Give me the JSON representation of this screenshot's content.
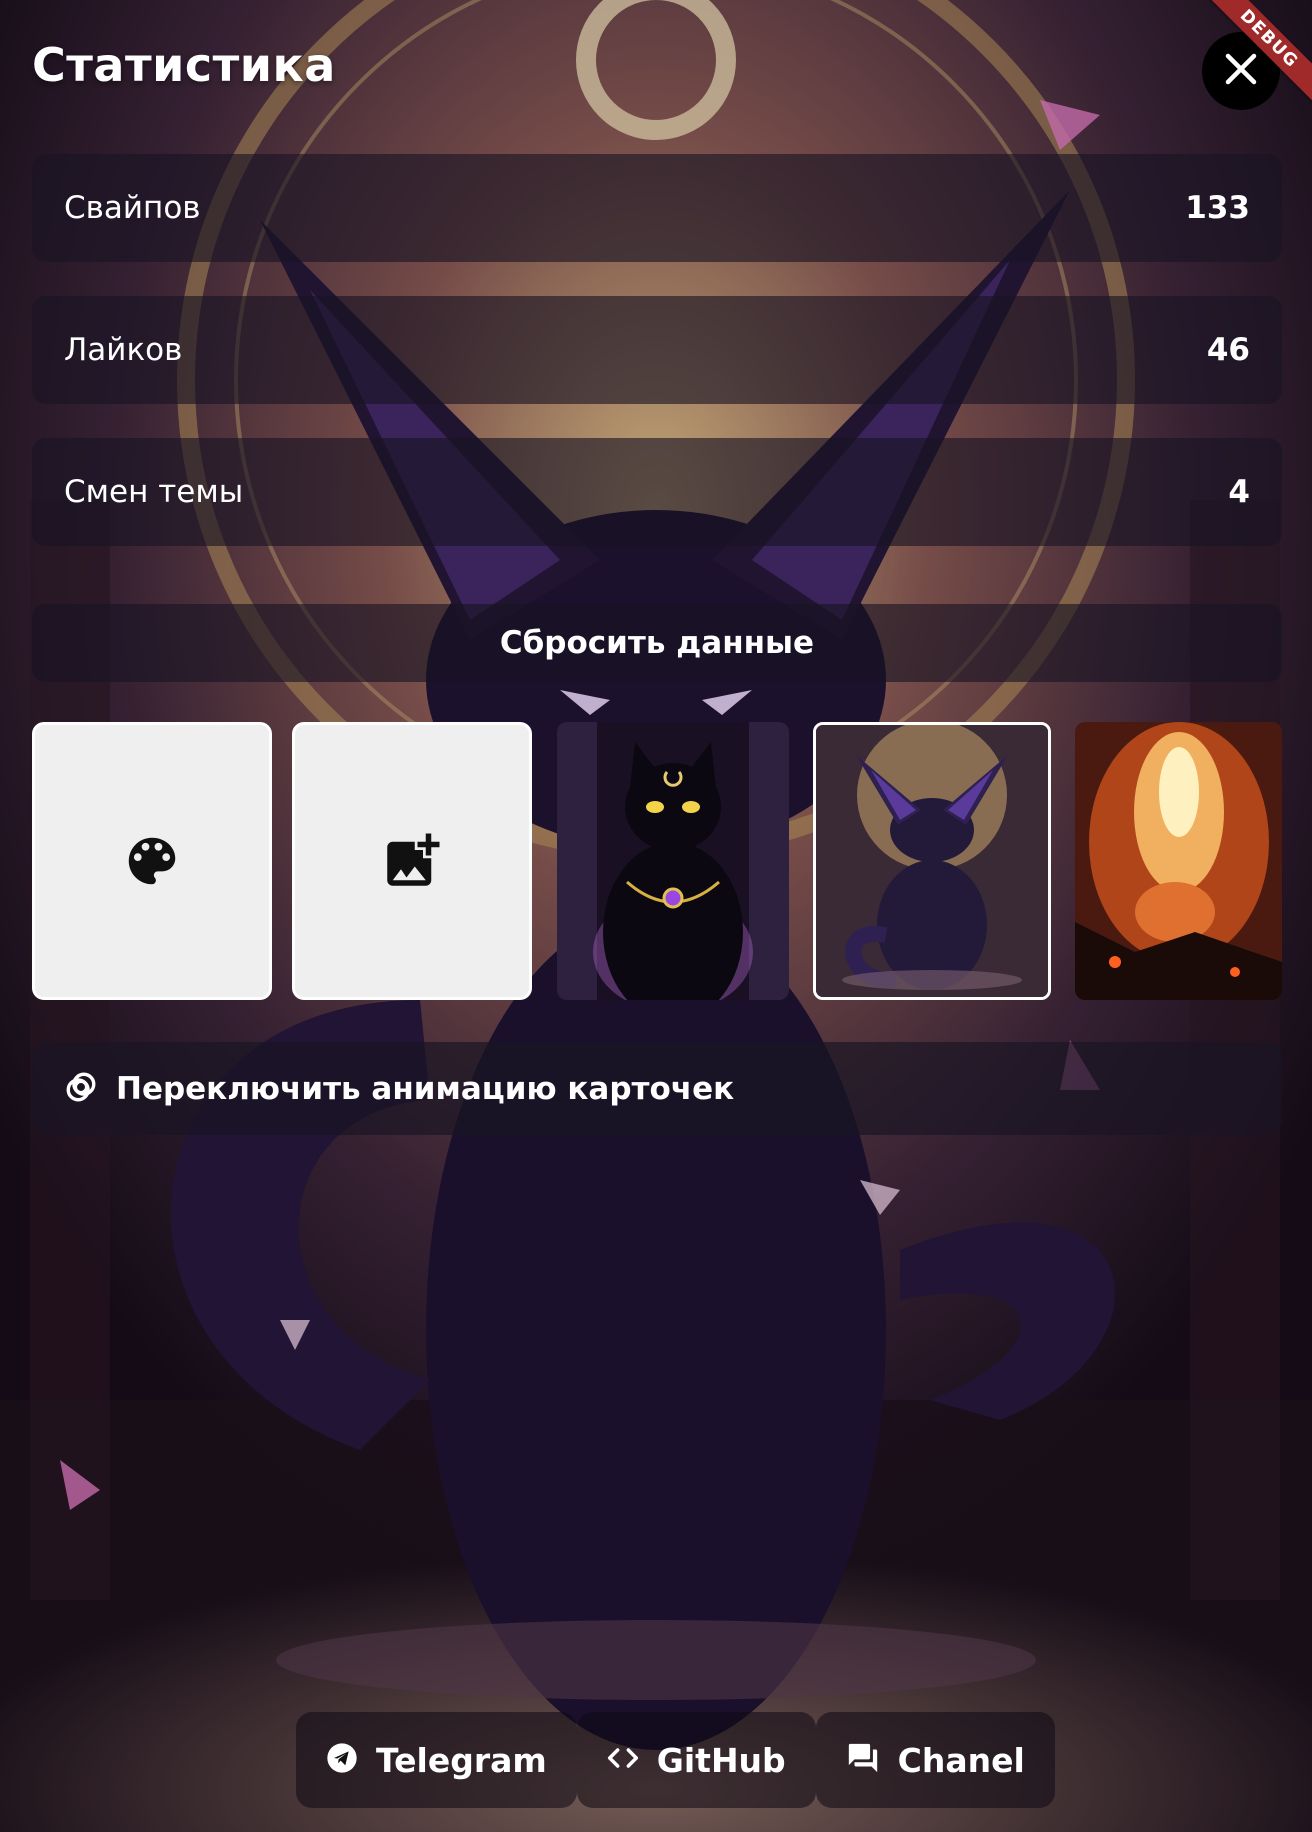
{
  "header": {
    "title": "Статистика",
    "debug_label": "DEBUG"
  },
  "stats": [
    {
      "label": "Свайпов",
      "value": "133"
    },
    {
      "label": "Лайков",
      "value": "46"
    },
    {
      "label": "Смен темы",
      "value": "4"
    }
  ],
  "reset_label": "Сбросить данные",
  "themes": {
    "tiles": [
      {
        "kind": "palette-icon"
      },
      {
        "kind": "add-photo-icon"
      },
      {
        "kind": "black-cat-theme"
      },
      {
        "kind": "purple-fox-theme",
        "selected": true
      },
      {
        "kind": "fire-fox-theme"
      }
    ]
  },
  "animation_toggle_label": "Переключить анимацию карточек",
  "footer": {
    "links": [
      {
        "label": "Telegram",
        "icon": "telegram-icon"
      },
      {
        "label": "GitHub",
        "icon": "code-icon"
      },
      {
        "label": "Chanel",
        "icon": "chat-icon"
      }
    ]
  },
  "colors": {
    "panel": "#191423",
    "debug_ribbon": "#a02a2a",
    "tile_bg": "#efefef"
  }
}
